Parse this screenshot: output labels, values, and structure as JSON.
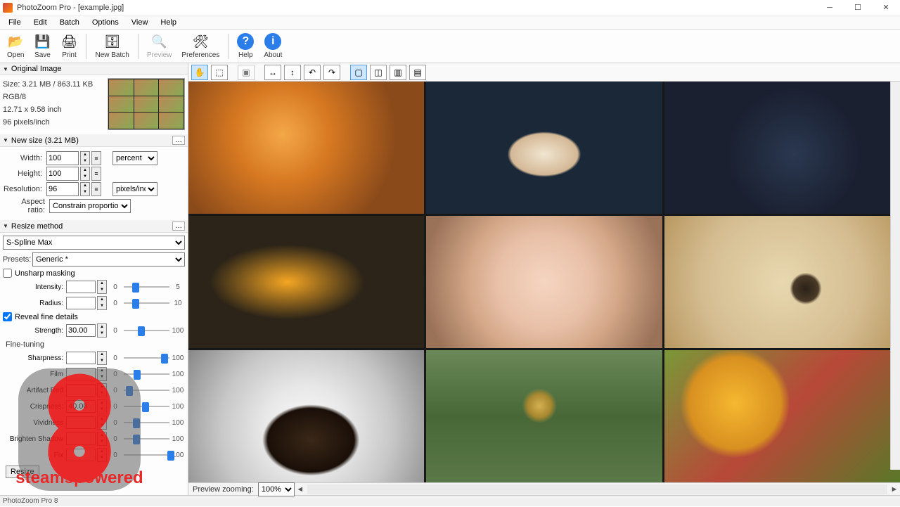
{
  "window": {
    "title": "PhotoZoom Pro    - [example.jpg]"
  },
  "menu": [
    "File",
    "Edit",
    "Batch",
    "Options",
    "View",
    "Help"
  ],
  "toolbar": [
    {
      "label": "Open",
      "icon": "📂"
    },
    {
      "label": "Save",
      "icon": "💾"
    },
    {
      "label": "Print",
      "icon": "🖨"
    },
    {
      "sep": true
    },
    {
      "label": "New Batch",
      "icon": "🗄"
    },
    {
      "sep": true
    },
    {
      "label": "Preview",
      "icon": "🔍",
      "disabled": true
    },
    {
      "label": "Preferences",
      "icon": "🛠"
    },
    {
      "sep": true
    },
    {
      "label": "Help",
      "icon": "?"
    },
    {
      "label": "About",
      "icon": "i"
    }
  ],
  "original": {
    "header": "Original Image",
    "size": "Size: 3.21 MB / 863.11 KB",
    "mode": "RGB/8",
    "dims": "12.71 x 9.58 inch",
    "dpi": "96 pixels/inch"
  },
  "newsize": {
    "header": "New size (3.21 MB)",
    "width_lbl": "Width:",
    "width": "100",
    "height_lbl": "Height:",
    "height": "100",
    "res_lbl": "Resolution:",
    "res": "96",
    "unit1": "percent",
    "unit2": "pixels/inch",
    "aspect_lbl": "Aspect ratio:",
    "aspect": "Constrain proportions"
  },
  "resize": {
    "header": "Resize method",
    "method": "S-Spline Max",
    "presets_lbl": "Presets:",
    "presets": "Generic *",
    "unsharp": "Unsharp masking",
    "intensity_lbl": "Intensity:",
    "intensity": "",
    "int_min": "0",
    "int_max": "5",
    "radius_lbl": "Radius:",
    "radius": "",
    "rad_min": "0",
    "rad_max": "10",
    "reveal": "Reveal fine details",
    "strength_lbl": "Strength:",
    "strength": "30.00",
    "fine": "Fine-tuning",
    "sharp_lbl": "Sharpness:",
    "sharp": "",
    "film_lbl": "Film ",
    "film": "",
    "artifact_lbl": "Artifact Red",
    "artifact": "",
    "crisp_lbl": "Crispness:",
    "crisp": "40.00",
    "vivid_lbl": "Vividness",
    "vivid": "",
    "brighten_lbl": "Brighten Shadow",
    "brighten": "",
    "fix_lbl": "Fix",
    "fix": "",
    "min": "0",
    "max": "100",
    "resize_btn": "Resize"
  },
  "preview_bar": {
    "label": "Preview zooming:",
    "value": "100%"
  },
  "status": "PhotoZoom Pro 8",
  "watermark": "steamspowered"
}
